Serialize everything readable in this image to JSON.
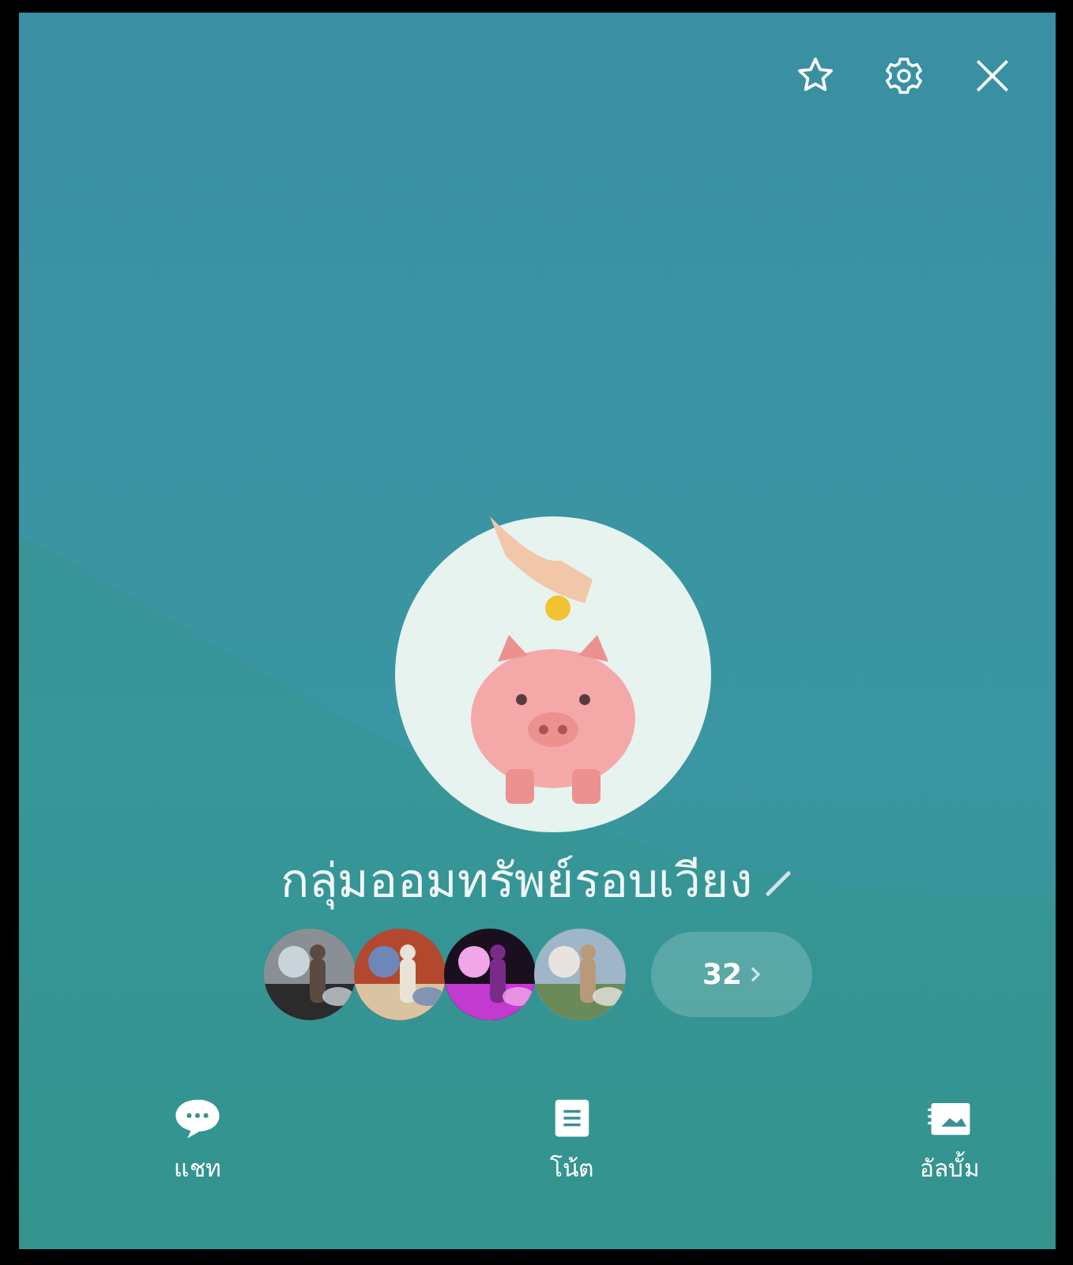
{
  "group": {
    "name": "กลุ่มออมทรัพย์รอบเวียง"
  },
  "member_count": "32",
  "actions": [
    {
      "kind": "chat",
      "label": "แชท"
    },
    {
      "kind": "note",
      "label": "โน้ต"
    },
    {
      "kind": "album",
      "label": "อัลบั้ม"
    }
  ]
}
